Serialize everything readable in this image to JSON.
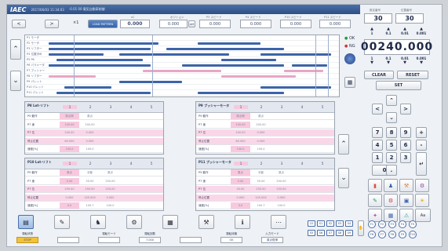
{
  "header": {
    "logo": "IAEC",
    "datetime": "2017/06/03 11:34:03",
    "title_info": "-0.01 00 電気自動車制御"
  },
  "toolbar": {
    "label_a": "sC",
    "value_a": "0.000",
    "label_b": "ポジション",
    "value_b": "0.000",
    "label_c": "P3 スピード",
    "value_c": "0.000",
    "label_d": "P4 スピード",
    "value_d": "0.000",
    "label_e": "P10 スピード",
    "value_e": "0.000",
    "label_f": "P11 スピード",
    "value_f": "0.000",
    "step_label": "×1",
    "mode_label": "LOAD PATTERN",
    "opt_label": "OFF"
  },
  "timeline": {
    "rows": [
      "P1 モータ",
      "P2 モータ",
      "P3 リフター",
      "P4 位置決め",
      "P5 P6",
      "P6 パラメータ",
      "P7 プッシャー",
      "P8 リフター",
      "P9 パレット",
      "P10 パレット",
      "P11 パレット"
    ]
  },
  "status": {
    "ok": "OK",
    "ng": "NG"
  },
  "keypad": {
    "top_l_label": "設定番号",
    "top_r_label": "位置番号",
    "top_l": "30",
    "top_r": "30",
    "units": [
      "1",
      "0.1",
      "0.01",
      "0.001"
    ],
    "units2": [
      "1",
      "0.1",
      "0.01",
      "0.001"
    ],
    "display": "00240.000",
    "clear": "CLEAR",
    "reset": "RESET",
    "set": "SET",
    "keys": [
      "7",
      "8",
      "9",
      "+",
      "4",
      "5",
      "6",
      "-",
      "1",
      "2",
      "3",
      "0",
      "."
    ]
  },
  "tables": [
    {
      "title": "P8 Lot-リフト",
      "cols": [
        "1",
        "2",
        "3",
        "4",
        "5"
      ],
      "rows": [
        {
          "label": "P5 動作",
          "cells": [
            "原点側",
            "原点",
            ""
          ]
        },
        {
          "label": "P7 速",
          "cells": [
            "100.00",
            "200.00",
            ""
          ]
        },
        {
          "label": "P7 位",
          "cells": [
            "240.00",
            "0.000",
            ""
          ]
        },
        {
          "label": "停止位置",
          "cells": [
            "60.000",
            "0.000",
            ""
          ]
        },
        {
          "label": "速度[%]",
          "cells": [
            "100.0",
            "100.0",
            ""
          ]
        }
      ]
    },
    {
      "title": "P9 プッシャーモータ",
      "cols": [
        "1",
        "2",
        "3",
        "4",
        "5"
      ],
      "rows": [
        {
          "label": "P5 動作",
          "cells": [
            "原点側",
            "原点",
            ""
          ]
        },
        {
          "label": "P7 速",
          "cells": [
            "100.00",
            "200.00",
            ""
          ]
        },
        {
          "label": "P7 位",
          "cells": [
            "100.00",
            "0.000",
            ""
          ]
        },
        {
          "label": "停止位置",
          "cells": [
            "60.000",
            "0.000",
            ""
          ]
        },
        {
          "label": "速度[%]",
          "cells": [
            "100.0",
            "100.0",
            ""
          ]
        }
      ]
    },
    {
      "title": "P10 Lot-リフト",
      "cols": [
        "1",
        "2",
        "3",
        "4",
        "5"
      ],
      "rows": [
        {
          "label": "P5 動作",
          "cells": [
            "原点",
            "手動",
            "原点"
          ]
        },
        {
          "label": "P7 速",
          "cells": [
            "0.00",
            "50.00",
            "200.00"
          ]
        },
        {
          "label": "P7 位",
          "cells": [
            "250.00",
            "250.00",
            "250.00"
          ]
        },
        {
          "label": "停止位置",
          "cells": [
            "0.000",
            "145.000",
            "0.000"
          ]
        },
        {
          "label": "速度[%]",
          "cells": [
            "0.0",
            "100.7",
            "100.0"
          ]
        }
      ]
    },
    {
      "title": "P11 プッシャーモータ",
      "cols": [
        "1",
        "2",
        "3",
        "4",
        "5"
      ],
      "rows": [
        {
          "label": "P5 動作",
          "cells": [
            "原点",
            "手動",
            "原点"
          ]
        },
        {
          "label": "P7 速",
          "cells": [
            "0.00",
            "50.00",
            "200.00"
          ]
        },
        {
          "label": "P7 位",
          "cells": [
            "40.00",
            "250.00",
            "250.00"
          ]
        },
        {
          "label": "停止位置",
          "cells": [
            "0.000",
            "145.000",
            "0.000"
          ]
        },
        {
          "label": "速度[%]",
          "cells": [
            "0.0",
            "100.7",
            "100.0"
          ]
        }
      ]
    }
  ],
  "bottom": {
    "items": [
      {
        "label": "運転状態",
        "value": "STOP"
      },
      {
        "label": "",
        "value": ""
      },
      {
        "label": "運転モード",
        "value": ""
      },
      {
        "label": "運転回数",
        "value": "7.000"
      },
      {
        "label": "",
        "value": ""
      },
      {
        "label": "運転待機",
        "value": "OK"
      },
      {
        "label": "入力モード",
        "value": "原点復帰"
      }
    ],
    "s_keys": [
      "C0",
      "S1",
      "S2",
      "S3",
      "S4",
      "S5",
      "S6",
      "S7",
      "S8",
      "S9"
    ],
    "f_keys": [
      "F1",
      "F2",
      "F3",
      "F4",
      "F5",
      "F6",
      "F7",
      "F8",
      "F9",
      "F10"
    ],
    "aa": "Aa"
  },
  "colors": {
    "accent": "#3d64a8",
    "pink": "#e8a6c6",
    "header": "#2d4f86"
  }
}
